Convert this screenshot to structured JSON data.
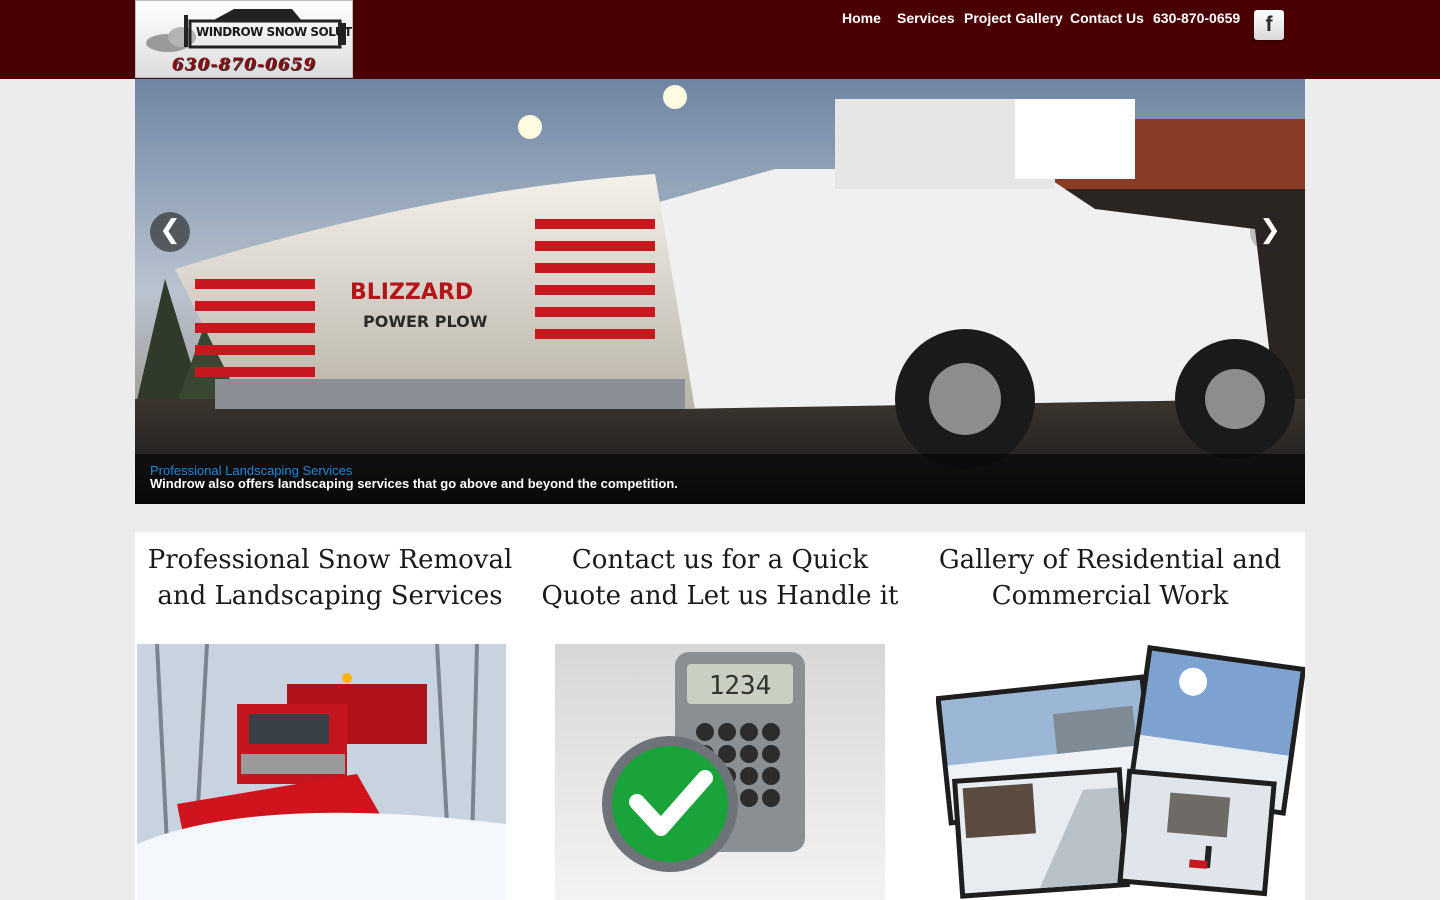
{
  "header": {
    "logo_brand": "WINDROW SNOW SOLUTIONS",
    "logo_phone": "630-870-0659",
    "nav": [
      {
        "label": "Home"
      },
      {
        "label": "Services"
      },
      {
        "label": "Project Gallery"
      },
      {
        "label": "Contact Us"
      },
      {
        "label": "630-870-0659"
      }
    ],
    "social_icon": "facebook-icon",
    "social_glyph": "f"
  },
  "slider": {
    "truck_blade_text_1": "BLIZZARD",
    "truck_blade_text_2": "POWER PLOW",
    "caption_title": "Professional Landscaping Services",
    "caption_text": "Windrow also offers landscaping services that go above and beyond the competition.",
    "prev_glyph": "❮",
    "next_glyph": "❯"
  },
  "features": [
    {
      "heading": "Professional Snow Removal and Landscaping Services"
    },
    {
      "heading": "Contact us for a Quick Quote and Let us Handle it"
    },
    {
      "heading": "Gallery of Residential and Commercial Work"
    }
  ],
  "images": {
    "calculator_display": "1234"
  },
  "colors": {
    "header_bg": "#4a0003",
    "caption_title": "#1e88d8",
    "page_bg": "#ececec"
  }
}
